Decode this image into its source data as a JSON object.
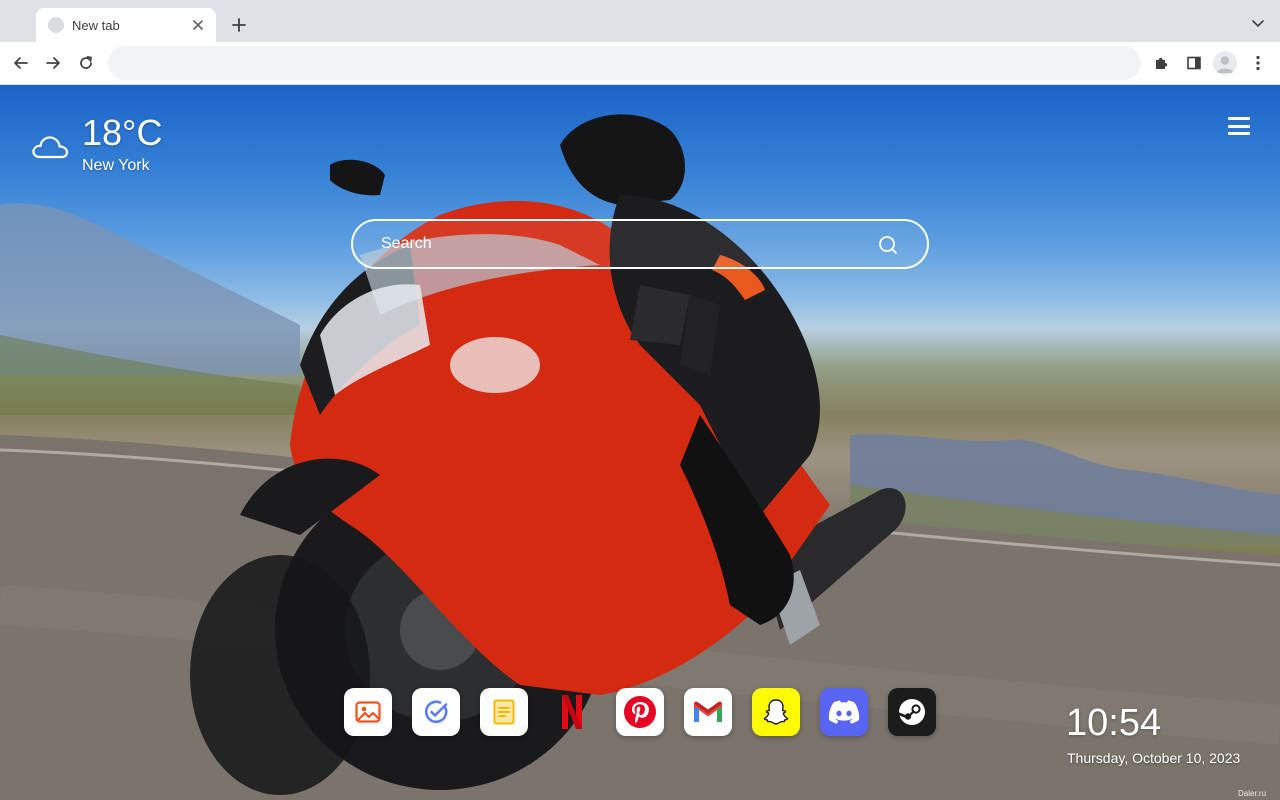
{
  "browser": {
    "tab": {
      "title": "New tab"
    },
    "omnibox": {
      "value": "",
      "placeholder": ""
    }
  },
  "icons": {
    "tab_favicon": "globe-icon",
    "tab_close": "close-icon",
    "new_tab": "plus-icon",
    "tab_search": "chevron-down-icon",
    "back": "arrow-left-icon",
    "forward": "arrow-right-icon",
    "reload": "reload-icon",
    "extensions": "puzzle-icon",
    "side_panel": "side-panel-icon",
    "profile": "avatar-icon",
    "more": "kebab-menu-icon",
    "weather": "cloud-icon",
    "search": "search-icon",
    "menu": "hamburger-icon"
  },
  "weather": {
    "temperature": "18°C",
    "city": "New York"
  },
  "search": {
    "placeholder": "Search"
  },
  "shortcuts": [
    {
      "name": "photos",
      "icon": "image-icon",
      "bg": "#ffffff",
      "color": "#f4511e"
    },
    {
      "name": "tasks",
      "icon": "check-circle-icon",
      "bg": "#ffffff",
      "color": "#5b7cf6"
    },
    {
      "name": "notes",
      "icon": "note-icon",
      "bg": "#ffffff",
      "color": "#f6b900"
    },
    {
      "name": "netflix",
      "icon": "netflix-icon",
      "bg": "transparent",
      "color": "#e50914"
    },
    {
      "name": "pinterest",
      "icon": "pinterest-icon",
      "bg": "#ffffff",
      "color": "#e60023"
    },
    {
      "name": "gmail",
      "icon": "gmail-icon",
      "bg": "#ffffff",
      "color": "#ea4335"
    },
    {
      "name": "snapchat",
      "icon": "snapchat-icon",
      "bg": "#fffc00",
      "color": "#ffffff"
    },
    {
      "name": "discord",
      "icon": "discord-icon",
      "bg": "#5865f2",
      "color": "#ffffff"
    },
    {
      "name": "steam",
      "icon": "steam-icon",
      "bg": "#1b1b1b",
      "color": "#ffffff"
    }
  ],
  "clock": {
    "time": "10:54",
    "date": "Thursday, October 10, 2023"
  },
  "watermark": "Daler.ru"
}
